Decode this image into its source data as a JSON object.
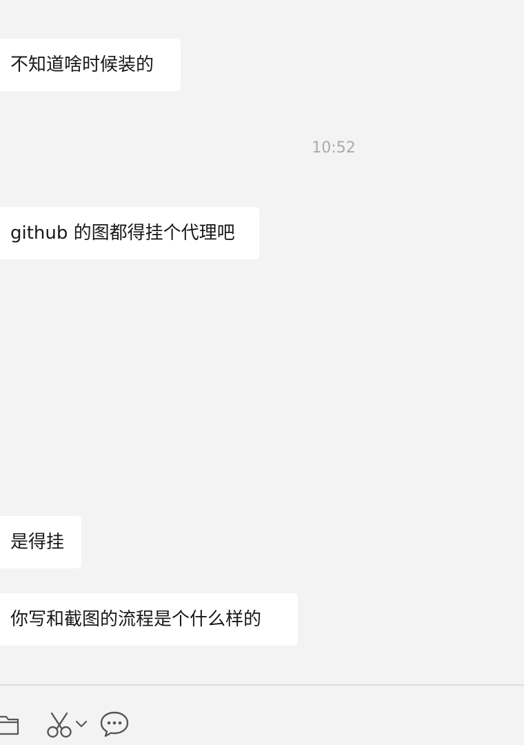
{
  "messages": [
    {
      "text": "不知道啥时候装的"
    },
    {
      "text": "github 的图都得挂个代理吧"
    },
    {
      "text": "是得挂"
    },
    {
      "text": "你写和截图的流程是个什么样的"
    }
  ],
  "timestamp": "10:52",
  "toolbar": {
    "icons": [
      "folder-icon",
      "scissors-icon",
      "chevron-down-icon",
      "chat-bubble-icon"
    ]
  }
}
